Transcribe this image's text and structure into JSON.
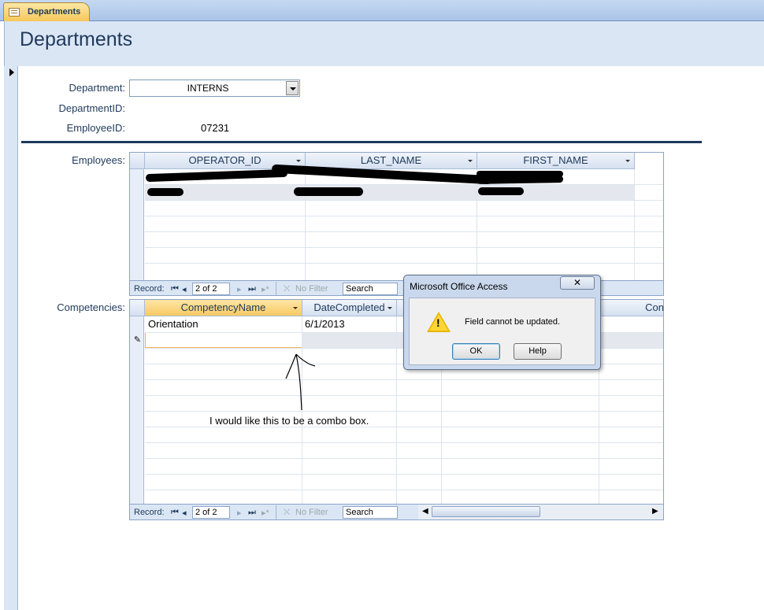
{
  "tab": {
    "label": "Departments",
    "icon": "form-icon"
  },
  "page_title": "Departments",
  "fields": {
    "department_label": "Department:",
    "department_value": "INTERNS",
    "departmentid_label": "DepartmentID:",
    "employeeid_label": "EmployeeID:",
    "employeeid_value": "07231"
  },
  "employees": {
    "label": "Employees:",
    "columns": [
      "OPERATOR_ID",
      "LAST_NAME",
      "FIRST_NAME"
    ],
    "navigator": {
      "record_label": "Record:",
      "position": "2 of 2",
      "filter": "No Filter",
      "search": "Search"
    }
  },
  "competencies": {
    "label": "Competencies:",
    "columns": [
      "CompetencyName",
      "DateCompleted",
      "Con"
    ],
    "rows": [
      {
        "name": "Orientation",
        "date": "6/1/2013"
      }
    ],
    "navigator": {
      "record_label": "Record:",
      "position": "2 of 2",
      "filter": "No Filter",
      "search": "Search"
    }
  },
  "annotation": "I would like this to be a combo box.",
  "dialog": {
    "title": "Microsoft Office Access",
    "message": "Field cannot be updated.",
    "ok": "OK",
    "help": "Help",
    "close": "✕"
  }
}
